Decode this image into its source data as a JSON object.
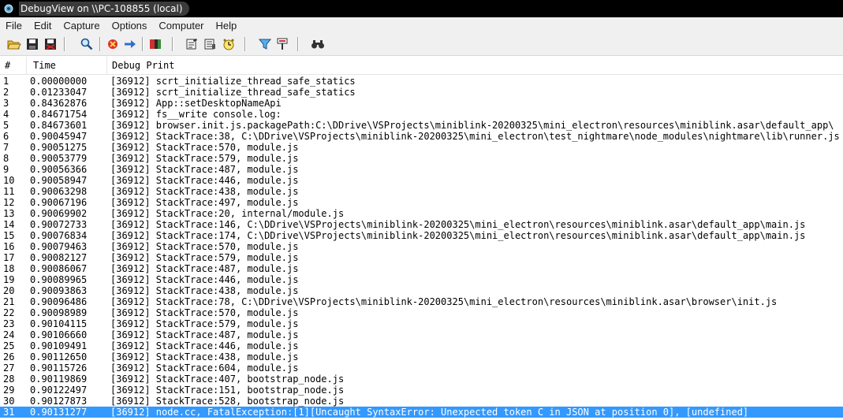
{
  "window": {
    "title": "DebugView on \\\\PC-108855 (local)",
    "icon": "debugview-app-icon"
  },
  "menu": [
    "File",
    "Edit",
    "Capture",
    "Options",
    "Computer",
    "Help"
  ],
  "toolbar": {
    "buttons": [
      {
        "name": "open-icon"
      },
      {
        "name": "save-icon"
      },
      {
        "name": "log-to-file-icon"
      },
      {
        "name": "capture-icon"
      },
      {
        "name": "autoscroll-icon"
      },
      {
        "name": "clear-display-icon"
      },
      {
        "name": "time-format-icon"
      },
      {
        "name": "filter-icon"
      },
      {
        "name": "clock-icon"
      },
      {
        "name": "highlight-icon"
      },
      {
        "name": "history-depth-icon"
      },
      {
        "name": "find-icon"
      }
    ]
  },
  "columns": {
    "num": "#",
    "time": "Time",
    "message": "Debug Print"
  },
  "colors": {
    "selection": "#3399ff",
    "titlebar": "#000000",
    "chrome": "#f0f0f0"
  },
  "rows": [
    {
      "num": "1",
      "time": "0.00000000",
      "msg": "[36912] scrt_initialize_thread_safe_statics"
    },
    {
      "num": "2",
      "time": "0.01233047",
      "msg": "[36912] scrt_initialize_thread_safe_statics"
    },
    {
      "num": "3",
      "time": "0.84362876",
      "msg": "[36912] App::setDesktopNameApi"
    },
    {
      "num": "4",
      "time": "0.84671754",
      "msg": "[36912] fs__write console.log:"
    },
    {
      "num": "5",
      "time": "0.84673601",
      "msg": "[36912] browser.init.js.packagePath:C:\\DDrive\\VSProjects\\miniblink-20200325\\mini_electron\\resources\\miniblink.asar\\default_app\\"
    },
    {
      "num": "6",
      "time": "0.90045947",
      "msg": "[36912] StackTrace:38, C:\\DDrive\\VSProjects\\miniblink-20200325\\mini_electron\\test_nightmare\\node_modules\\nightmare\\lib\\runner.js"
    },
    {
      "num": "7",
      "time": "0.90051275",
      "msg": "[36912] StackTrace:570, module.js"
    },
    {
      "num": "8",
      "time": "0.90053779",
      "msg": "[36912] StackTrace:579, module.js"
    },
    {
      "num": "9",
      "time": "0.90056366",
      "msg": "[36912] StackTrace:487, module.js"
    },
    {
      "num": "10",
      "time": "0.90058947",
      "msg": "[36912] StackTrace:446, module.js"
    },
    {
      "num": "11",
      "time": "0.90063298",
      "msg": "[36912] StackTrace:438, module.js"
    },
    {
      "num": "12",
      "time": "0.90067196",
      "msg": "[36912] StackTrace:497, module.js"
    },
    {
      "num": "13",
      "time": "0.90069902",
      "msg": "[36912] StackTrace:20, internal/module.js"
    },
    {
      "num": "14",
      "time": "0.90072733",
      "msg": "[36912] StackTrace:146, C:\\DDrive\\VSProjects\\miniblink-20200325\\mini_electron\\resources\\miniblink.asar\\default_app\\main.js"
    },
    {
      "num": "15",
      "time": "0.90076834",
      "msg": "[36912] StackTrace:174, C:\\DDrive\\VSProjects\\miniblink-20200325\\mini_electron\\resources\\miniblink.asar\\default_app\\main.js"
    },
    {
      "num": "16",
      "time": "0.90079463",
      "msg": "[36912] StackTrace:570, module.js"
    },
    {
      "num": "17",
      "time": "0.90082127",
      "msg": "[36912] StackTrace:579, module.js"
    },
    {
      "num": "18",
      "time": "0.90086067",
      "msg": "[36912] StackTrace:487, module.js"
    },
    {
      "num": "19",
      "time": "0.90089965",
      "msg": "[36912] StackTrace:446, module.js"
    },
    {
      "num": "20",
      "time": "0.90093863",
      "msg": "[36912] StackTrace:438, module.js"
    },
    {
      "num": "21",
      "time": "0.90096486",
      "msg": "[36912] StackTrace:78, C:\\DDrive\\VSProjects\\miniblink-20200325\\mini_electron\\resources\\miniblink.asar\\browser\\init.js"
    },
    {
      "num": "22",
      "time": "0.90098989",
      "msg": "[36912] StackTrace:570, module.js"
    },
    {
      "num": "23",
      "time": "0.90104115",
      "msg": "[36912] StackTrace:579, module.js"
    },
    {
      "num": "24",
      "time": "0.90106660",
      "msg": "[36912] StackTrace:487, module.js"
    },
    {
      "num": "25",
      "time": "0.90109491",
      "msg": "[36912] StackTrace:446, module.js"
    },
    {
      "num": "26",
      "time": "0.90112650",
      "msg": "[36912] StackTrace:438, module.js"
    },
    {
      "num": "27",
      "time": "0.90115726",
      "msg": "[36912] StackTrace:604, module.js"
    },
    {
      "num": "28",
      "time": "0.90119869",
      "msg": "[36912] StackTrace:407, bootstrap_node.js"
    },
    {
      "num": "29",
      "time": "0.90122497",
      "msg": "[36912] StackTrace:151, bootstrap_node.js"
    },
    {
      "num": "30",
      "time": "0.90127873",
      "msg": "[36912] StackTrace:528, bootstrap_node.js"
    },
    {
      "num": "31",
      "time": "0.90131277",
      "msg": "[36912] node.cc, FatalException:[1][Uncaught SyntaxError: Unexpected token C in JSON at position 0], [undefined]",
      "selected": true
    }
  ]
}
